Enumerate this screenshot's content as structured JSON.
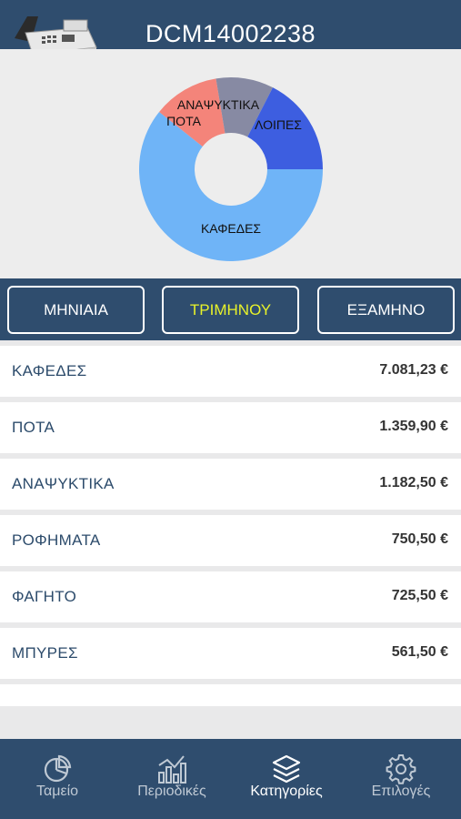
{
  "header": {
    "title": "DCM14002238"
  },
  "chart_data": {
    "type": "pie",
    "categories": [
      "ΚΑΦΕΔΕΣ",
      "ΠΟΤΑ",
      "ΑΝΑΨΥΚΤΙΚΑ",
      "ΛΟΙΠΕΣ"
    ],
    "values": [
      7081.23,
      1359.9,
      1182.5,
      2037.5
    ],
    "colors": [
      "#6fb4f7",
      "#f4847a",
      "#878aa3",
      "#3d5ee0"
    ],
    "donut": true
  },
  "periods": [
    {
      "label": "ΜΗΝΙΑΙΑ",
      "active": false
    },
    {
      "label": "ΤΡΙΜΗΝΟΥ",
      "active": true
    },
    {
      "label": "ΕΞΑΜΗΝΟ",
      "active": false
    }
  ],
  "rows": [
    {
      "name": "ΚΑΦΕΔΕΣ",
      "value": "7.081,23 €"
    },
    {
      "name": "ΠΟΤΑ",
      "value": "1.359,90 €"
    },
    {
      "name": "ΑΝΑΨΥΚΤΙΚΑ",
      "value": "1.182,50 €"
    },
    {
      "name": "ΡΟΦΗΜΑΤΑ",
      "value": "750,50 €"
    },
    {
      "name": "ΦΑΓΗΤΟ",
      "value": "725,50 €"
    },
    {
      "name": "ΜΠΥΡΕΣ",
      "value": "561,50 €"
    }
  ],
  "tabs": [
    {
      "label": "Ταμείο",
      "icon": "pie-chart-icon",
      "active": false
    },
    {
      "label": "Περιοδικές",
      "icon": "bar-chart-icon",
      "active": false
    },
    {
      "label": "Κατηγορίες",
      "icon": "layers-icon",
      "active": true
    },
    {
      "label": "Επιλογές",
      "icon": "gear-icon",
      "active": false
    }
  ]
}
